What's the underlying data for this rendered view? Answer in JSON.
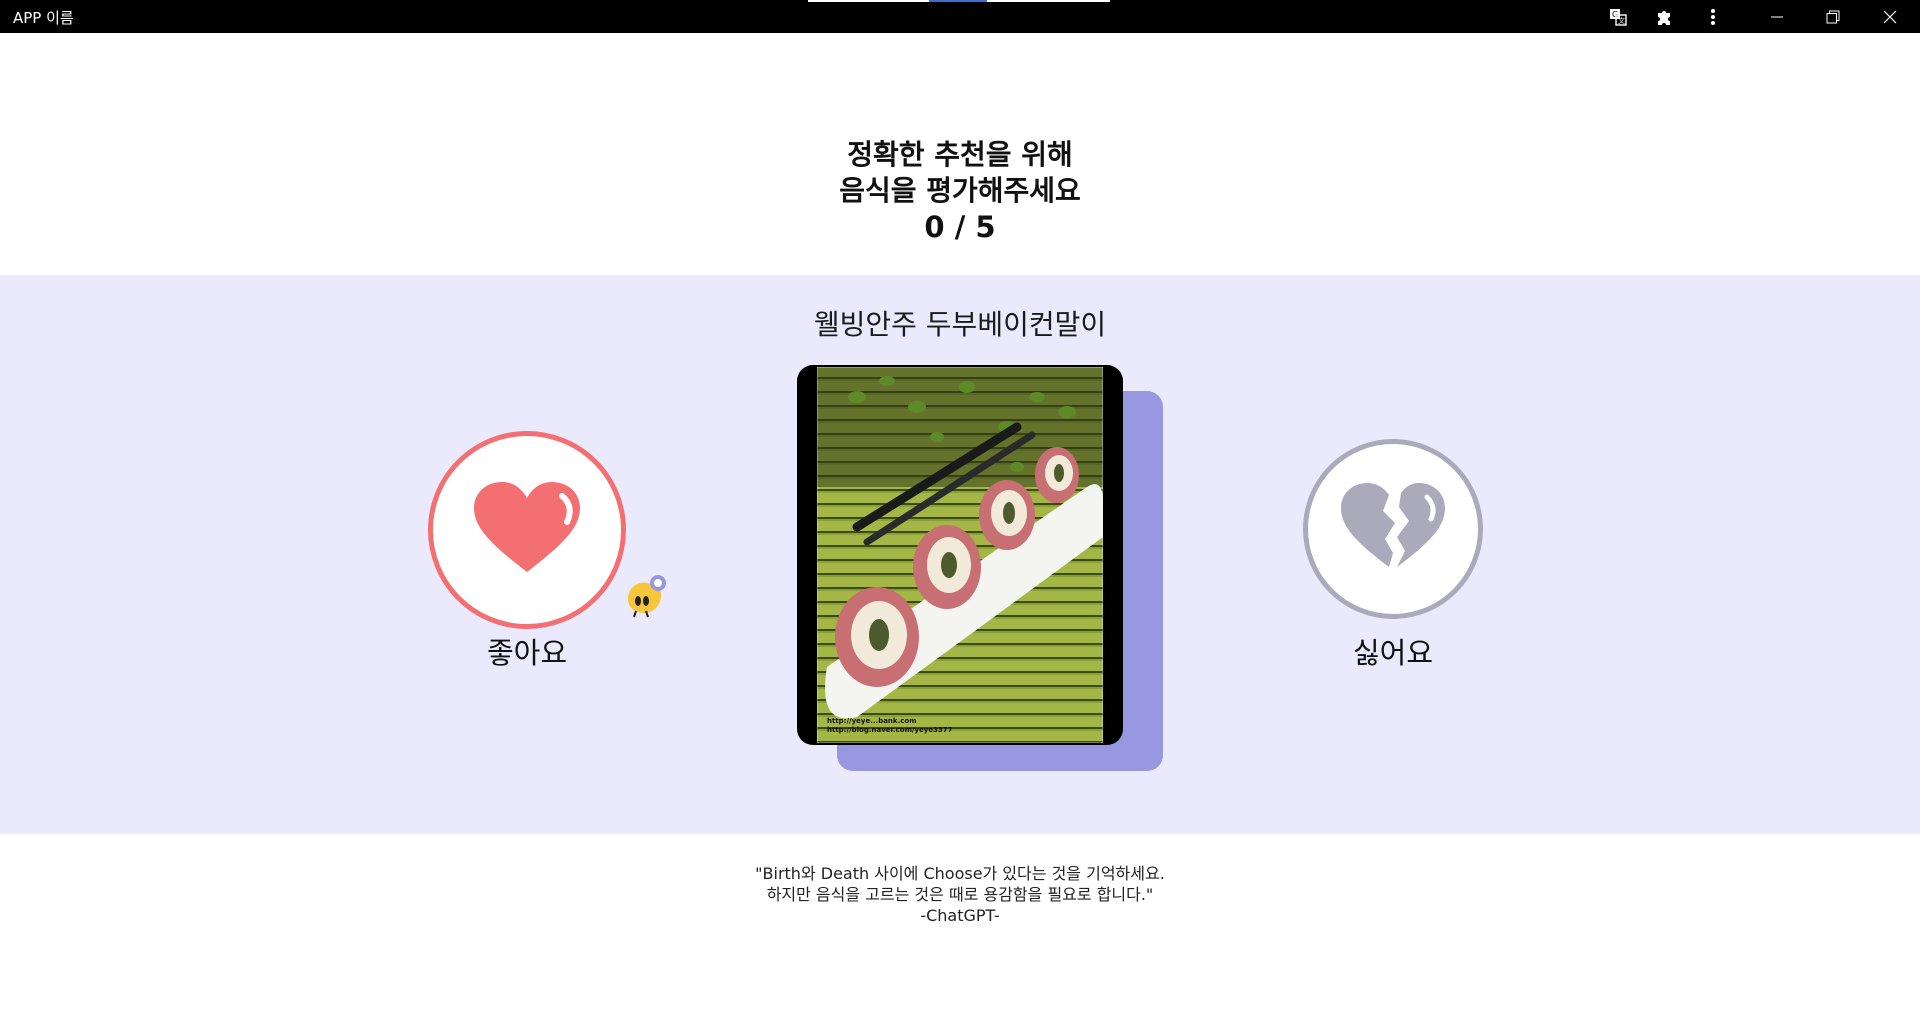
{
  "window": {
    "app_name": "APP 이름"
  },
  "header": {
    "line1": "정확한 추천을 위해",
    "line2": "음식을 평가해주세요",
    "progress": "0 / 5",
    "progress_current": 0,
    "progress_total": 5
  },
  "food": {
    "name": "웰빙안주 두부베이컨말이",
    "watermark_line1": "http://yeye...bank.com",
    "watermark_line2": "http://blog.naver.com/yeye3377"
  },
  "actions": {
    "like_label": "좋아요",
    "dislike_label": "싫어요"
  },
  "quote": {
    "line1": "\"Birth와 Death 사이에 Choose가 있다는 것을 기억하세요.",
    "line2": "하지만 음식을 고르는 것은 때로 용감함을 필요로 합니다.\"",
    "author": "-ChatGPT-"
  },
  "colors": {
    "titlebar": "#000000",
    "panel_bg": "#eaeafc",
    "card_shadow": "#9898e0",
    "like": "#f36f72",
    "dislike": "#aaaabb"
  }
}
